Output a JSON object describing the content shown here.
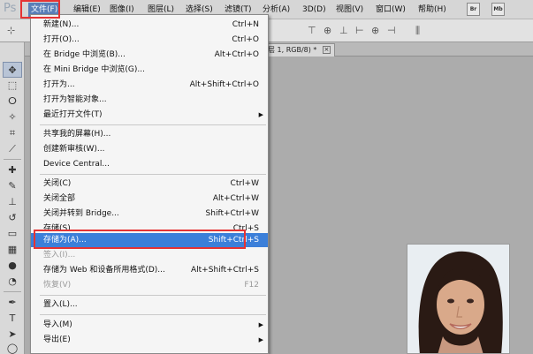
{
  "app": {
    "logo": "Ps"
  },
  "menubar": {
    "items": [
      {
        "label": "文件(F)",
        "active": true
      },
      {
        "label": "编辑(E)"
      },
      {
        "label": "图像(I)"
      },
      {
        "label": "图层(L)"
      },
      {
        "label": "选择(S)"
      },
      {
        "label": "滤镜(T)"
      },
      {
        "label": "分析(A)"
      },
      {
        "label": "3D(D)"
      },
      {
        "label": "视图(V)"
      },
      {
        "label": "窗口(W)"
      },
      {
        "label": "帮助(H)"
      }
    ],
    "buttons": [
      "Br",
      "Mb"
    ]
  },
  "document": {
    "tab_label": "层 1, RGB/8) *",
    "tab_close": "×"
  },
  "file_menu": {
    "items": [
      {
        "label": "新建(N)...",
        "shortcut": "Ctrl+N"
      },
      {
        "label": "打开(O)...",
        "shortcut": "Ctrl+O"
      },
      {
        "label": "在 Bridge 中浏览(B)...",
        "shortcut": "Alt+Ctrl+O"
      },
      {
        "label": "在 Mini Bridge 中浏览(G)...",
        "shortcut": ""
      },
      {
        "label": "打开为...",
        "shortcut": "Alt+Shift+Ctrl+O"
      },
      {
        "label": "打开为智能对象...",
        "shortcut": ""
      },
      {
        "label": "最近打开文件(T)",
        "shortcut": "",
        "submenu": true
      },
      {
        "label": "共享我的屏幕(H)...",
        "shortcut": ""
      },
      {
        "label": "创建新审核(W)...",
        "shortcut": ""
      },
      {
        "label": "Device Central...",
        "shortcut": ""
      },
      {
        "label": "关闭(C)",
        "shortcut": "Ctrl+W"
      },
      {
        "label": "关闭全部",
        "shortcut": "Alt+Ctrl+W"
      },
      {
        "label": "关闭并转到 Bridge...",
        "shortcut": "Shift+Ctrl+W"
      },
      {
        "label": "存储(S)",
        "shortcut": "Ctrl+S"
      },
      {
        "label": "存储为(A)...",
        "shortcut": "Shift+Ctrl+S",
        "highlighted": true
      },
      {
        "label": "签入(I)...",
        "shortcut": "",
        "disabled": true
      },
      {
        "label": "存储为 Web 和设备所用格式(D)...",
        "shortcut": "Alt+Shift+Ctrl+S"
      },
      {
        "label": "恢复(V)",
        "shortcut": "F12",
        "disabled": true
      },
      {
        "label": "置入(L)...",
        "shortcut": ""
      },
      {
        "label": "导入(M)",
        "shortcut": "",
        "submenu": true
      },
      {
        "label": "导出(E)",
        "shortcut": "",
        "submenu": true
      }
    ],
    "submenu_arrow": "▶"
  },
  "colors": {
    "highlight": "#3b7fd9",
    "callout": "#e53333",
    "menubar_active": "#5a7fb8"
  }
}
